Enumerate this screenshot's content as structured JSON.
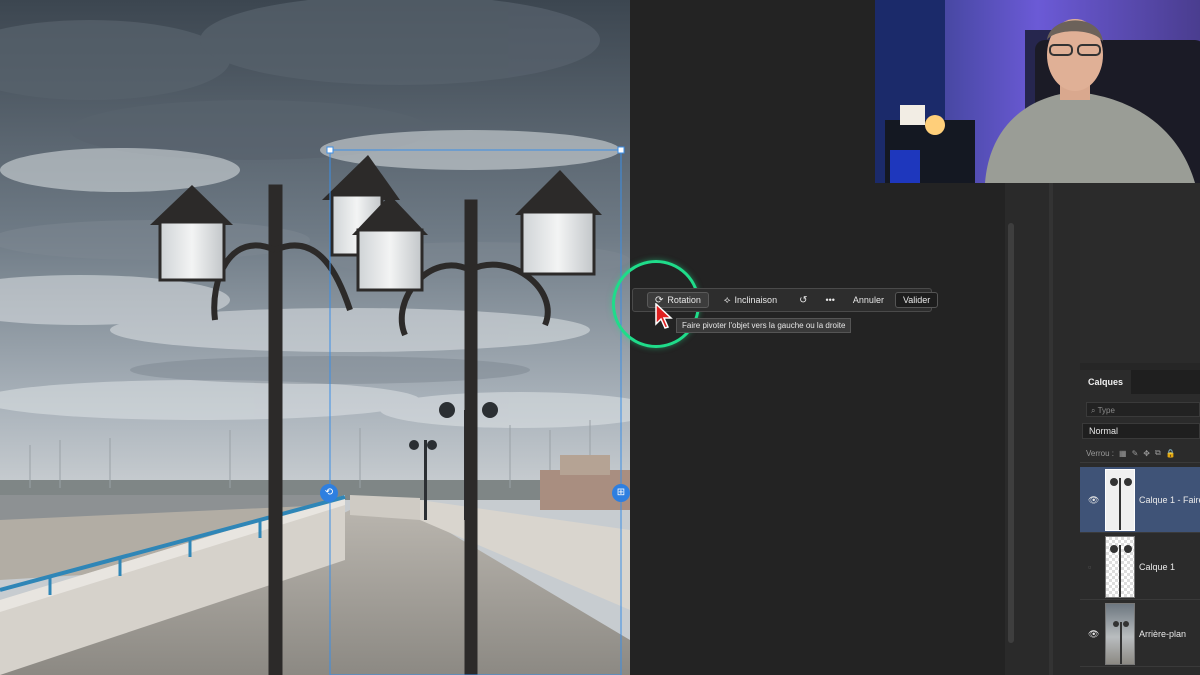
{
  "taskbar": {
    "rotation_label": "Rotation",
    "inclinaison_label": "Inclinaison",
    "more_label": "•••",
    "annuler_label": "Annuler",
    "valider_label": "Valider",
    "tooltip": "Faire pivoter l'objet vers la gauche ou la droite"
  },
  "layers_panel": {
    "tab_label": "Calques",
    "search_placeholder": "Type",
    "blend_mode": "Normal",
    "lock_label": "Verrou :",
    "layers": [
      {
        "name": "Calque 1 - Faire",
        "visible": true,
        "selected": true
      },
      {
        "name": "Calque 1",
        "visible": false,
        "selected": false
      },
      {
        "name": "Arrière-plan",
        "visible": true,
        "selected": false
      }
    ]
  },
  "colors": {
    "accent_ring": "#1fdc8a",
    "selected_layer": "#3f5377",
    "transform_box": "#3a8ee6"
  }
}
